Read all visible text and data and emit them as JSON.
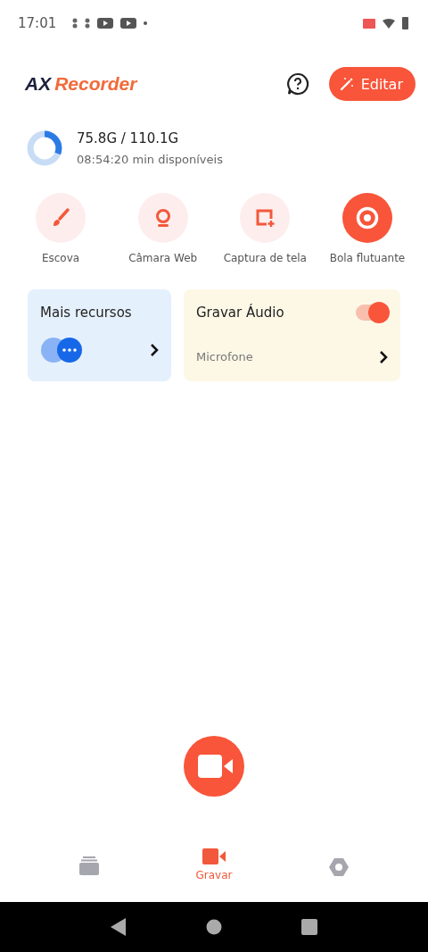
{
  "status_bar": {
    "time": "17:01"
  },
  "header": {
    "logo": {
      "prefix": "AX",
      "name": "Recorder"
    },
    "edit_button": "Editar"
  },
  "storage": {
    "level": 0.31,
    "usage": "75.8G / 110.1G",
    "remaining": "08:54:20 min disponíveis"
  },
  "tools": [
    {
      "kind": "brush",
      "label": "Escova",
      "on": false
    },
    {
      "kind": "webcam",
      "label": "Câmara Web",
      "on": false
    },
    {
      "kind": "screenshot",
      "label": "Captura de tela",
      "on": false
    },
    {
      "kind": "floating",
      "label": "Bola flutuante",
      "on": true
    }
  ],
  "cards": {
    "more": {
      "title": "Mais recursos"
    },
    "audio": {
      "title": "Gravar Áudio",
      "on": true,
      "source": "Microfone"
    }
  },
  "bottom_nav": [
    {
      "kind": "library",
      "selected": false
    },
    {
      "kind": "record",
      "label": "Gravar",
      "selected": true
    },
    {
      "kind": "settings",
      "selected": false
    }
  ]
}
